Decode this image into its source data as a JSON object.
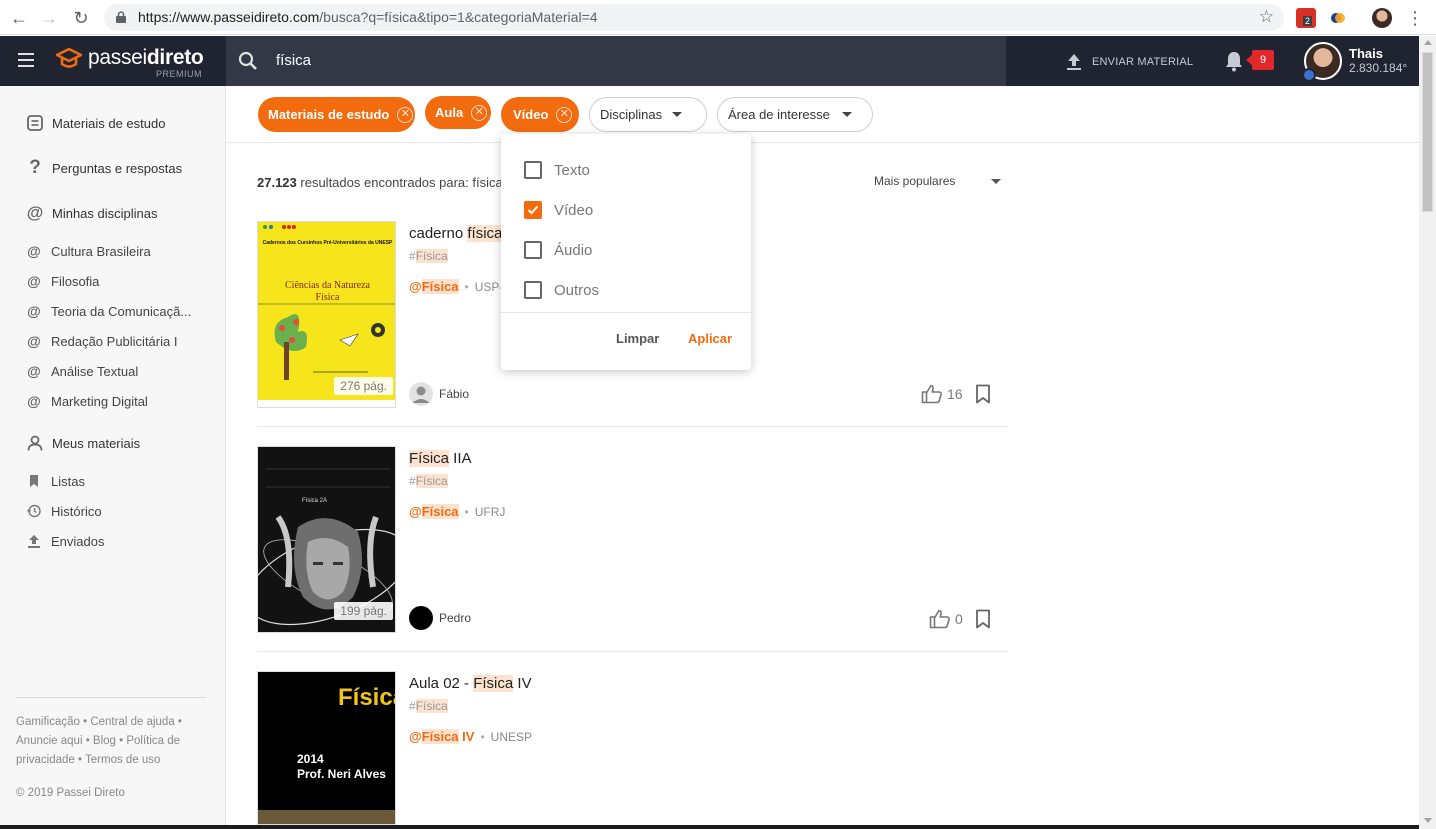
{
  "browser": {
    "url_host": "https://www.passeidireto.com",
    "url_path": "/busca?q=física&tipo=1&categoriaMaterial=4",
    "ext_badge": "2"
  },
  "header": {
    "logo_light": "passei",
    "logo_bold": "direto",
    "logo_sub": "PREMIUM",
    "search_query": "física",
    "upload_label": "ENVIAR MATERIAL",
    "notification_count": "9",
    "user_name": "Thais",
    "user_points": "2.830.184°"
  },
  "sidebar": {
    "heads": [
      "Materiais de estudo",
      "Perguntas e respostas",
      "Minhas disciplinas",
      "Meus materiais"
    ],
    "disciplines": [
      "Cultura Brasileira",
      "Filosofia",
      "Teoria da Comunicaçã...",
      "Redação Publicitária I",
      "Análise Textual",
      "Marketing Digital"
    ],
    "materials": [
      "Listas",
      "Histórico",
      "Enviados"
    ],
    "footer": "Gamificação • Central de ajuda • Anuncie aqui • Blog • Política de privacidade • Termos de uso",
    "copyright": "© 2019 Passei Direto"
  },
  "filters": {
    "active": [
      "Materiais de estudo",
      "Aula",
      "Vídeo"
    ],
    "dropdowns": [
      "Disciplinas",
      "Área de interesse"
    ]
  },
  "results": {
    "count": "27.123",
    "count_suffix": "resultados encontrados para:",
    "query": "física",
    "sort": "Mais populares"
  },
  "dropdown": {
    "options": [
      {
        "label": "Texto",
        "checked": false
      },
      {
        "label": "Vídeo",
        "checked": true
      },
      {
        "label": "Áudio",
        "checked": false
      },
      {
        "label": "Outros",
        "checked": false
      }
    ],
    "clear": "Limpar",
    "apply": "Aplicar"
  },
  "cards": [
    {
      "title_pre": "caderno ",
      "title_hl": "física",
      "title_post": "",
      "tag_hash": "#",
      "tag": "Física",
      "discipline_at": "@",
      "discipline": "Física",
      "discipline_post": "",
      "institution": "USP-S",
      "author": "Fábio",
      "likes": "16",
      "pages": "276 pág.",
      "cover_top": "Cadernos dos Cursinhos Pré-Universitários da UNESP",
      "cover_title_1": "Ciências da Natureza",
      "cover_title_2": "Física"
    },
    {
      "title_pre": "",
      "title_hl": "Física",
      "title_post": " IIA",
      "tag_hash": "#",
      "tag": "Física",
      "discipline_at": "@",
      "discipline": "Física",
      "discipline_post": "",
      "institution": "UFRJ",
      "author": "Pedro",
      "likes": "0",
      "pages": "199 pág.",
      "cover_text": "Física 2A"
    },
    {
      "title_pre": "Aula 02 - ",
      "title_hl": "Física",
      "title_post": " IV",
      "tag_hash": "#",
      "tag": "Física",
      "discipline_at": "@",
      "discipline": "Física",
      "discipline_post": " IV",
      "institution": "UNESP",
      "cover_title": "Física",
      "cover_year": "2014",
      "cover_author": "Prof. Neri Alves"
    }
  ],
  "colors": {
    "accent": "#f26b0f",
    "appbar": "#1f2430",
    "search": "#323846"
  }
}
